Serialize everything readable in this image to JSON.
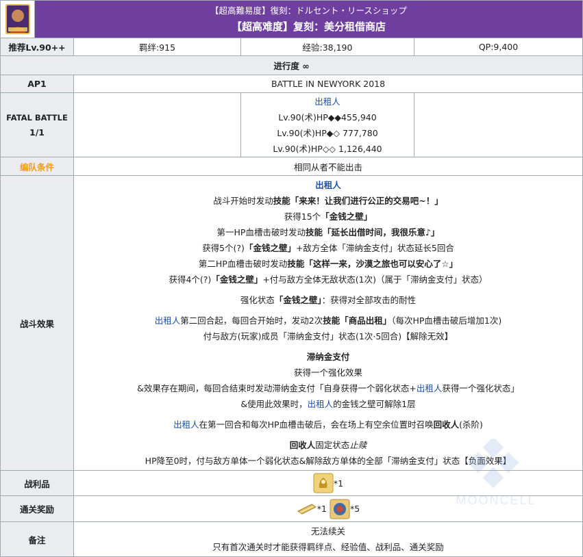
{
  "header": {
    "title_jp": "【超高難易度】復刻：ドルセント・リースショップ",
    "title_cn": "【超高难度】复刻：美分租借商店"
  },
  "stats": {
    "level": "推荐Lv.90++",
    "bond": "羁绊:915",
    "exp": "经验:38,190",
    "qp": "QP:9,400"
  },
  "progress": "进行度 ∞",
  "ap": {
    "label": "AP1",
    "value": "BATTLE IN NEWYORK 2018"
  },
  "fatal": {
    "label": "FATAL BATTLE",
    "count": "1/1",
    "enemy_name": "出租人",
    "hp_lines": [
      "Lv.90(术)HP◆◆455,940",
      "Lv.90(术)HP◆◇ 777,780",
      "Lv.90(术)HP◇◇ 1,126,440"
    ]
  },
  "formation": {
    "label": "编队条件",
    "value": "相同从者不能出击"
  },
  "effects": {
    "label": "战斗效果",
    "title": "出租人",
    "l1a": "战斗开始时发动",
    "l1b": "技能「来来！让我们进行公正的交易吧~！」",
    "l2a": "获得15个",
    "l2b": "「金钱之壁」",
    "l3a": "第一HP血槽击破时发动",
    "l3b": "技能「延长出借时间，我很乐意♪」",
    "l4a": "获得5个(?)",
    "l4b": "「金钱之壁」",
    "l4c": "+敌方全体「滞纳金支付」状态延长5回合",
    "l5a": "第二HP血槽击破时发动",
    "l5b": "技能「这样一来，沙漠之旅也可以安心了☆」",
    "l6a": "获得4个(?)",
    "l6b": "「金钱之壁」",
    "l6c": "+付与敌方全体无敌状态(1次)（属于「滞纳金支付」状态）",
    "l7a": "强化状态",
    "l7b": "「金钱之壁」",
    "l7c": "：获得对全部攻击的耐性",
    "l8a": "出租人",
    "l8b": "第二回合起，每回合开始时，发动2次",
    "l8c": "技能「商品出租」",
    "l8d": "（每次HP血槽击破后增加1次)",
    "l9": "付与敌方(玩家)成员「滞纳金支付」状态(1次·5回合)【解除无效】",
    "l10": "滞纳金支付",
    "l11": "获得一个强化效果",
    "l12a": "&效果存在期间，每回合结束时发动滞纳金支付「自身获得一个弱化状态+",
    "l12b": "出租人",
    "l12c": "获得一个强化状态」",
    "l13a": "&使用此效果时，",
    "l13b": "出租人",
    "l13c": "的金钱之壁可解除1层",
    "l14a": "出租人",
    "l14b": "在第一回合和每次HP血槽击破后，会在场上有空余位置时召唤",
    "l14c": "回收人",
    "l14d": "(杀阶)",
    "l15a": "回收人",
    "l15b": "固定状态",
    "l15c": "止赎",
    "l16": "HP降至0时，付与敌方单体一个弱化状态&解除敌方单体的全部「滞纳金支付」状态【负面效果】"
  },
  "loot": {
    "label": "战利品",
    "qty": "*1"
  },
  "reward": {
    "label": "通关奖励",
    "qty1": "*1",
    "qty2": "*5"
  },
  "notes": {
    "label": "备注",
    "line1": "无法续关",
    "line2": "只有首次通关时才能获得羁绊点、经验值、战利品、通关奖励"
  },
  "watermark": "MOONCELL",
  "colors": {
    "header": "#6f3fa0",
    "label_bg": "#eaecf0",
    "link": "#1d4fa3",
    "highlight": "#f49b1a"
  }
}
